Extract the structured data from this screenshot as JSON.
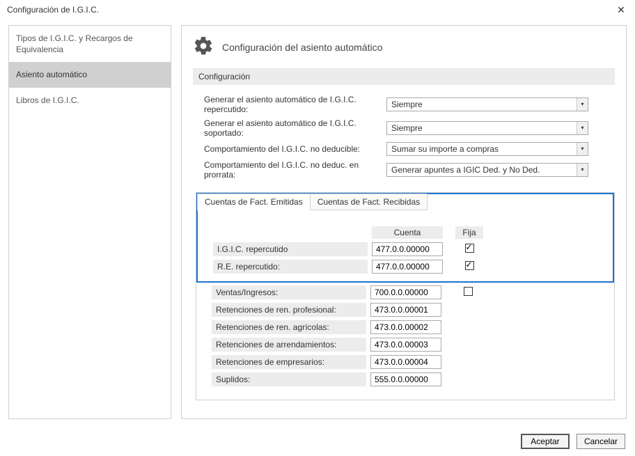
{
  "window": {
    "title": "Configuración de I.G.I.C."
  },
  "sidebar": {
    "items": [
      {
        "label": "Tipos de I.G.I.C. y Recargos de Equivalencia"
      },
      {
        "label": "Asiento automático"
      },
      {
        "label": "Libros de I.G.I.C."
      }
    ]
  },
  "header": {
    "title": "Configuración del asiento automático"
  },
  "subheader": "Configuración",
  "form": [
    {
      "label": "Generar el asiento automático de I.G.I.C. repercutido:",
      "value": "Siempre"
    },
    {
      "label": "Generar el asiento automático de I.G.I.C. soportado:",
      "value": "Siempre"
    },
    {
      "label": "Comportamiento del I.G.I.C. no deducible:",
      "value": "Sumar su importe a compras"
    },
    {
      "label": "Comportamiento del I.G.I.C. no deduc. en prorrata:",
      "value": "Generar apuntes a IGIC Ded. y No Ded."
    }
  ],
  "tabs": {
    "emitidas": "Cuentas de Fact. Emitidas",
    "recibidas": "Cuentas de Fact. Recibidas"
  },
  "columns": {
    "cuenta": "Cuenta",
    "fija": "Fija"
  },
  "rows_highlighted": [
    {
      "label": "I.G.I.C. repercutido",
      "cuenta": "477.0.0.00000",
      "fija_shown": true,
      "fija_checked": true
    },
    {
      "label": "R.E. repercutido:",
      "cuenta": "477.0.0.00000",
      "fija_shown": true,
      "fija_checked": true
    }
  ],
  "rows_rest": [
    {
      "label": "Ventas/Ingresos:",
      "cuenta": "700.0.0.00000",
      "fija_shown": true,
      "fija_checked": false
    },
    {
      "label": "Retenciones de ren. profesional:",
      "cuenta": "473.0.0.00001",
      "fija_shown": false,
      "fija_checked": false
    },
    {
      "label": "Retenciones de ren. agrícolas:",
      "cuenta": "473.0.0.00002",
      "fija_shown": false,
      "fija_checked": false
    },
    {
      "label": "Retenciones de arrendamientos:",
      "cuenta": "473.0.0.00003",
      "fija_shown": false,
      "fija_checked": false
    },
    {
      "label": "Retenciones de empresarios:",
      "cuenta": "473.0.0.00004",
      "fija_shown": false,
      "fija_checked": false
    },
    {
      "label": "Suplidos:",
      "cuenta": "555.0.0.00000",
      "fija_shown": false,
      "fija_checked": false
    }
  ],
  "footer": {
    "accept": "Aceptar",
    "cancel": "Cancelar"
  }
}
